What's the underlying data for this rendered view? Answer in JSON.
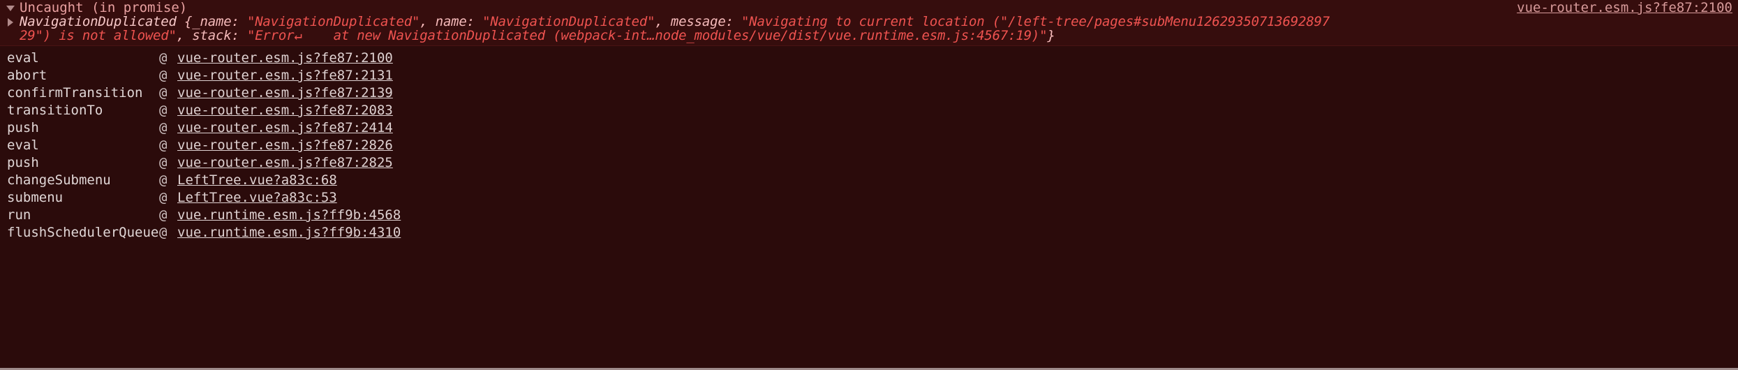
{
  "console": {
    "error": {
      "header_label": "Uncaught (in promise)",
      "header_source_link": "vue-router.esm.js?fe87:2100",
      "object_line_1_parts": {
        "class_name": "NavigationDuplicated",
        "open_brace": " {",
        "key_underscore_name": "_name: ",
        "value_underscore_name": "\"NavigationDuplicated\"",
        "sep_1": ", ",
        "key_name": "name: ",
        "value_name": "\"NavigationDuplicated\"",
        "sep_2": ", ",
        "key_message": "message: ",
        "value_message_head": "\"Navigating to current location (\"/left-tree/pages#subMenu12629350713692897"
      },
      "object_line_2_parts": {
        "value_message_tail": "29\") is not allowed\"",
        "sep_3": ", ",
        "key_stack": "stack: ",
        "value_stack": "\"Error↵    at new NavigationDuplicated (webpack-int…node_modules/vue/dist/vue.runtime.esm.js:4567:19)\"",
        "close_brace": "}"
      },
      "disclosure_expanded_icon": "triangle-down-icon",
      "disclosure_collapsed_icon": "triangle-right-icon"
    },
    "at_symbol": "@",
    "stack_frames": [
      {
        "function": "eval",
        "location": "vue-router.esm.js?fe87:2100"
      },
      {
        "function": "abort",
        "location": "vue-router.esm.js?fe87:2131"
      },
      {
        "function": "confirmTransition",
        "location": "vue-router.esm.js?fe87:2139"
      },
      {
        "function": "transitionTo",
        "location": "vue-router.esm.js?fe87:2083"
      },
      {
        "function": "push",
        "location": "vue-router.esm.js?fe87:2414"
      },
      {
        "function": "eval",
        "location": "vue-router.esm.js?fe87:2826"
      },
      {
        "function": "push",
        "location": "vue-router.esm.js?fe87:2825"
      },
      {
        "function": "changeSubmenu",
        "location": "LeftTree.vue?a83c:68"
      },
      {
        "function": "submenu",
        "location": "LeftTree.vue?a83c:53"
      },
      {
        "function": "run",
        "location": "vue.runtime.esm.js?ff9b:4568"
      },
      {
        "function": "flushSchedulerQueue",
        "location": "vue.runtime.esm.js?ff9b:4310"
      }
    ],
    "colors": {
      "panel_background": "#2b0b0b",
      "error_background": "#360d0d",
      "error_text": "#e8a0a0",
      "string_literal": "#ef5350",
      "frame_text": "#e0d6d6",
      "link_text": "#dfd2d2"
    }
  }
}
